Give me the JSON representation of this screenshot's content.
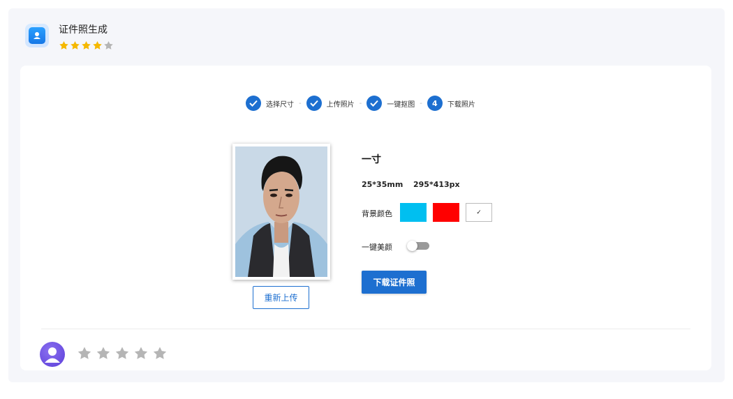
{
  "app": {
    "title": "证件照生成",
    "rating": 4,
    "rating_max": 5,
    "icon": "user-badge-icon",
    "accent_color": "#1d6fd0",
    "star_color": "#f5b800",
    "star_empty_color": "#b5b5b5"
  },
  "steps": [
    {
      "label": "选择尺寸",
      "state": "done",
      "marker": ""
    },
    {
      "label": "上传照片",
      "state": "done",
      "marker": ""
    },
    {
      "label": "一键抠图",
      "state": "done",
      "marker": ""
    },
    {
      "label": "下载照片",
      "state": "current",
      "marker": "4"
    }
  ],
  "step_separator": "-",
  "photo": {
    "reupload_label": "重新上传"
  },
  "size": {
    "name": "一寸",
    "mm": "25*35mm",
    "px": "295*413px"
  },
  "background": {
    "label": "背景颜色",
    "options": [
      {
        "color": "#00bff0",
        "selected": false
      },
      {
        "color": "#ff0000",
        "selected": false
      },
      {
        "color": "#ffffff",
        "selected": true,
        "mark": "✓"
      }
    ]
  },
  "beauty": {
    "label": "一键美颜",
    "enabled": false
  },
  "download_label": "下载证件照",
  "feedback": {
    "rating": 0,
    "rating_max": 5
  }
}
